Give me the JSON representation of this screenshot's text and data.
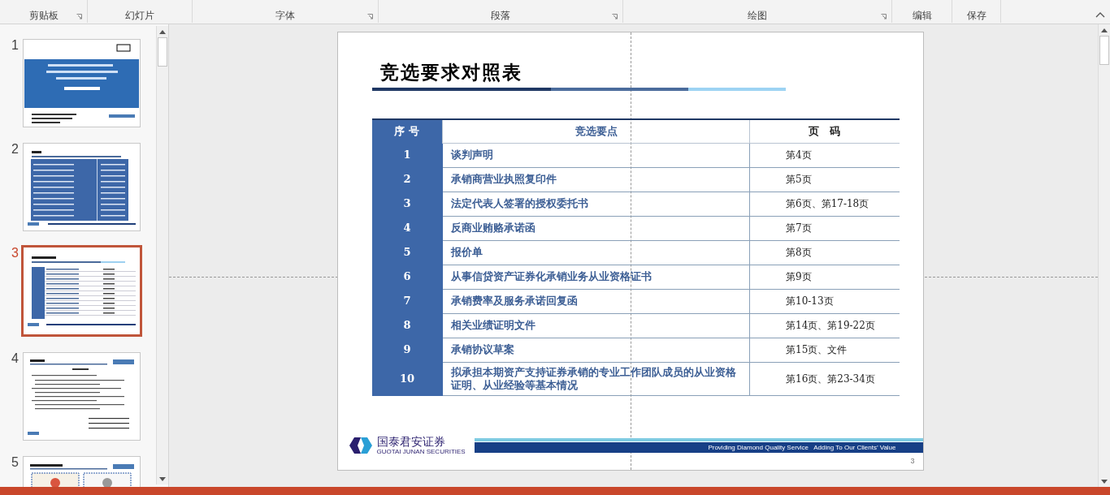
{
  "ribbon": {
    "groups": [
      {
        "label": "剪贴板",
        "launcher": true
      },
      {
        "label": "幻灯片",
        "launcher": false
      },
      {
        "label": "字体",
        "launcher": true
      },
      {
        "label": "段落",
        "launcher": true
      },
      {
        "label": "绘图",
        "launcher": true
      },
      {
        "label": "编辑",
        "launcher": false
      },
      {
        "label": "保存",
        "launcher": false
      }
    ]
  },
  "thumbnails": [
    {
      "number": "1",
      "kind": "cover",
      "selected": false
    },
    {
      "number": "2",
      "kind": "contents",
      "selected": false
    },
    {
      "number": "3",
      "kind": "table",
      "selected": true
    },
    {
      "number": "4",
      "kind": "letter",
      "selected": false
    },
    {
      "number": "5",
      "kind": "licenses",
      "selected": false
    }
  ],
  "slide": {
    "title": "竞选要求对照表",
    "table": {
      "columns": [
        "序 号",
        "竞选要点",
        "页　码"
      ],
      "rows": [
        {
          "no": "1",
          "item": "谈判声明",
          "pages": "第4页"
        },
        {
          "no": "2",
          "item": "承销商营业执照复印件",
          "pages": "第5页"
        },
        {
          "no": "3",
          "item": "法定代表人签署的授权委托书",
          "pages": "第6页、第17-18页"
        },
        {
          "no": "4",
          "item": "反商业贿赂承诺函",
          "pages": "第7页"
        },
        {
          "no": "5",
          "item": "报价单",
          "pages": "第8页"
        },
        {
          "no": "6",
          "item": "从事信贷资产证券化承销业务从业资格证书",
          "pages": "第9页"
        },
        {
          "no": "7",
          "item": "承销费率及服务承诺回复函",
          "pages": "第10-13页"
        },
        {
          "no": "8",
          "item": "相关业绩证明文件",
          "pages": "第14页、第19-22页"
        },
        {
          "no": "9",
          "item": "承销协议草案",
          "pages": "第15页、文件"
        },
        {
          "no": "10",
          "item": "拟承担本期资产支持证券承销的专业工作团队成员的从业资格证明、从业经验等基本情况",
          "pages": "第16页、第23-34页"
        }
      ]
    },
    "footer": {
      "logo_name": "国泰君安证券",
      "logo_sub": "GUOTAI JUNAN SECURITIES",
      "slogan": "Providing Diamond Quality Service   Adding To Our Clients’ Value",
      "page_number": "3"
    }
  }
}
